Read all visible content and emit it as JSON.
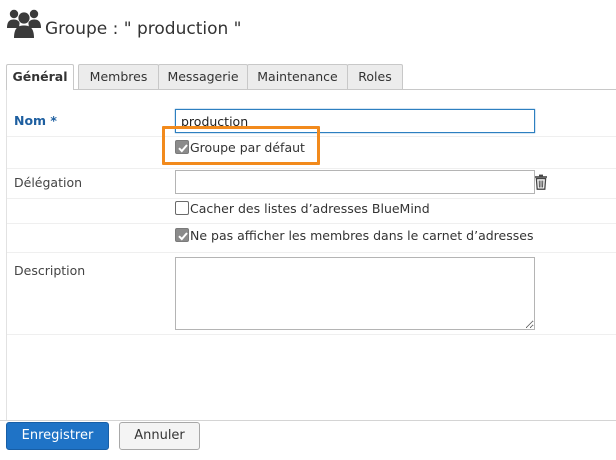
{
  "header": {
    "title": "Groupe : \" production \"",
    "icon": "users-group-icon"
  },
  "tabs": [
    {
      "label": "Général",
      "active": true
    },
    {
      "label": "Membres",
      "active": false
    },
    {
      "label": "Messagerie",
      "active": false
    },
    {
      "label": "Maintenance",
      "active": false
    },
    {
      "label": "Roles",
      "active": false
    }
  ],
  "form": {
    "name": {
      "label": "Nom *",
      "value": "production"
    },
    "default_group": {
      "label": "Groupe par défaut",
      "checked": true
    },
    "delegation": {
      "label": "Délégation",
      "value": "",
      "icon": "trash-icon"
    },
    "hide_from_lists": {
      "label": "Cacher des listes d’adresses BlueMind",
      "checked": false
    },
    "hide_members": {
      "label": "Ne pas afficher les membres dans le carnet d’adresses",
      "checked": true
    },
    "description": {
      "label": "Description",
      "value": ""
    }
  },
  "footer": {
    "save_label": "Enregistrer",
    "cancel_label": "Annuler"
  },
  "colors": {
    "primary": "#1f73c6",
    "required_label": "#1e5fa0",
    "highlight": "#f28a1c"
  }
}
